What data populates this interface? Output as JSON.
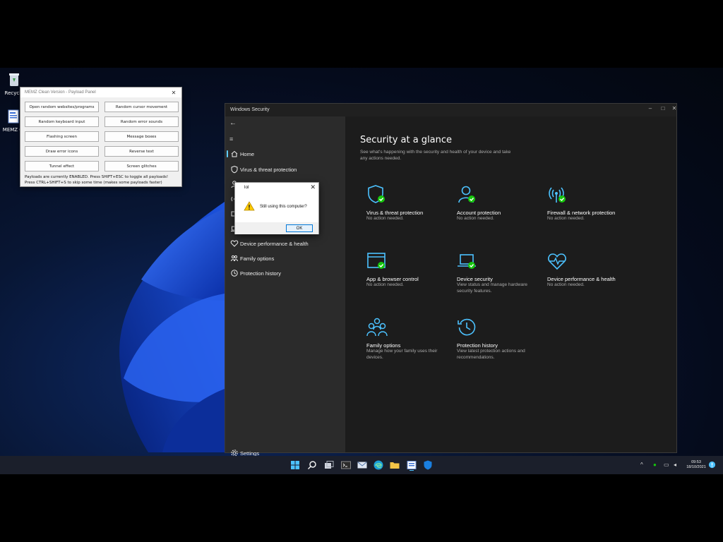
{
  "desktop": {
    "icons": [
      {
        "label": "Recycle"
      },
      {
        "label": "MEMZ C"
      }
    ]
  },
  "memz": {
    "title": "MEMZ Clean Version - Payload Panel",
    "buttons": [
      "Open random websites/programs",
      "Random cursor movement",
      "Random keyboard input",
      "Random error sounds",
      "Flashing screen",
      "Message boxes",
      "Draw error icons",
      "Reverse text",
      "Tunnel effect",
      "Screen glitches"
    ],
    "info_line1": "Payloads are currently ENABLED. Press SHIFT+ESC to toggle all payloads!",
    "info_line2": "Press CTRL+SHIFT+S to skip some time (makes some payloads faster)"
  },
  "windows_security": {
    "title": "Windows Security",
    "nav": {
      "home": "Home",
      "virus": "Virus & threat protection",
      "device_performance": "Device performance & health",
      "family": "Family options",
      "history": "Protection history",
      "settings": "Settings"
    },
    "heading": "Security at a glance",
    "subheading": "See what's happening with the security and health of your device and take any actions needed.",
    "tiles": [
      {
        "name": "Virus & threat protection",
        "status": "No action needed.",
        "icon": "shield-icon",
        "check": true
      },
      {
        "name": "Account protection",
        "status": "No action needed.",
        "icon": "person-icon",
        "check": true
      },
      {
        "name": "Firewall & network protection",
        "status": "No action needed.",
        "icon": "wifi-antenna-icon",
        "check": true
      },
      {
        "name": "App & browser control",
        "status": "No action needed.",
        "icon": "browser-window-icon",
        "check": true
      },
      {
        "name": "Device security",
        "status": "View status and manage hardware security features.",
        "icon": "laptop-icon",
        "check": true
      },
      {
        "name": "Device performance & health",
        "status": "No action needed.",
        "icon": "heart-pulse-icon",
        "check": false
      },
      {
        "name": "Family options",
        "status": "Manage how your family uses their devices.",
        "icon": "family-icon",
        "check": false
      },
      {
        "name": "Protection history",
        "status": "View latest protection actions and recommendations.",
        "icon": "history-icon",
        "check": false
      }
    ]
  },
  "dialog": {
    "title": "lol",
    "message": "Still using this computer?",
    "ok": "OK"
  },
  "taskbar": {
    "time": "09:53",
    "date": "18/10/2021"
  },
  "colors": {
    "accent": "#60cdff",
    "check_green": "#16c60c",
    "icon_blue": "#4cc2ff"
  }
}
